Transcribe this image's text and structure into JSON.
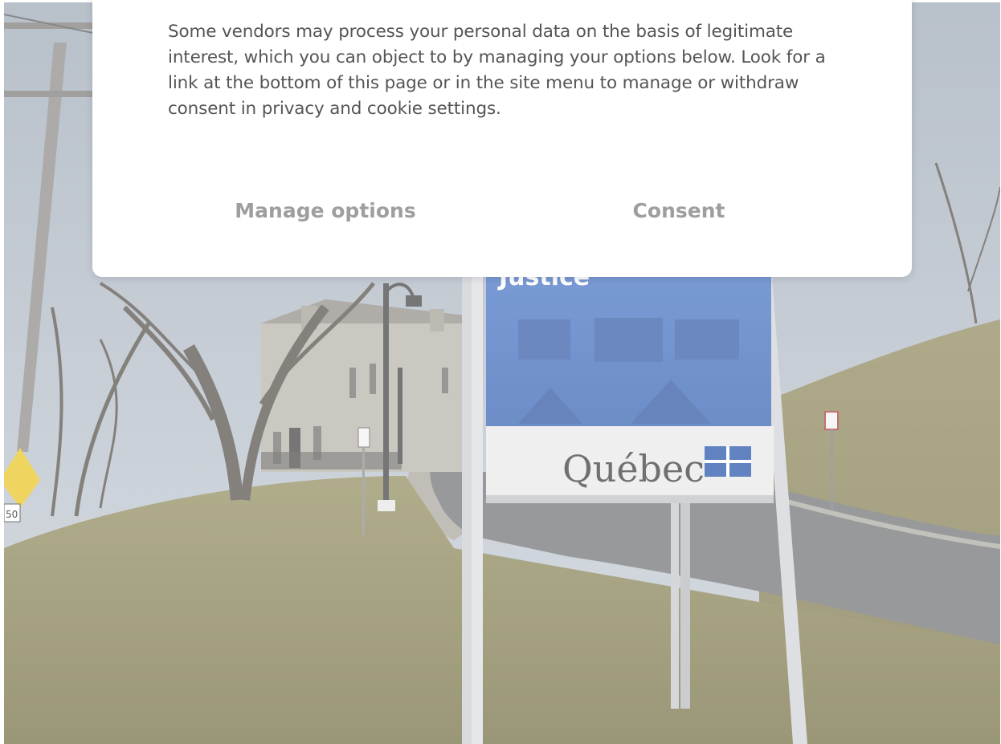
{
  "consent_dialog": {
    "body_text": "Some vendors may process your personal data on the basis of legitimate interest, which you can object to by managing your options below. Look for a link at the bottom of this page or in the site menu to manage or withdraw consent in privacy and cookie settings.",
    "manage_options_label": "Manage options",
    "consent_label": "Consent"
  },
  "background_photo": {
    "sign_word_partial": "Justice",
    "sign_brand": "Québec",
    "road_sign_speed": "50"
  },
  "colors": {
    "button_text": "#9e9e9e",
    "body_text": "#555555",
    "sign_blue": "#4a78c8"
  }
}
